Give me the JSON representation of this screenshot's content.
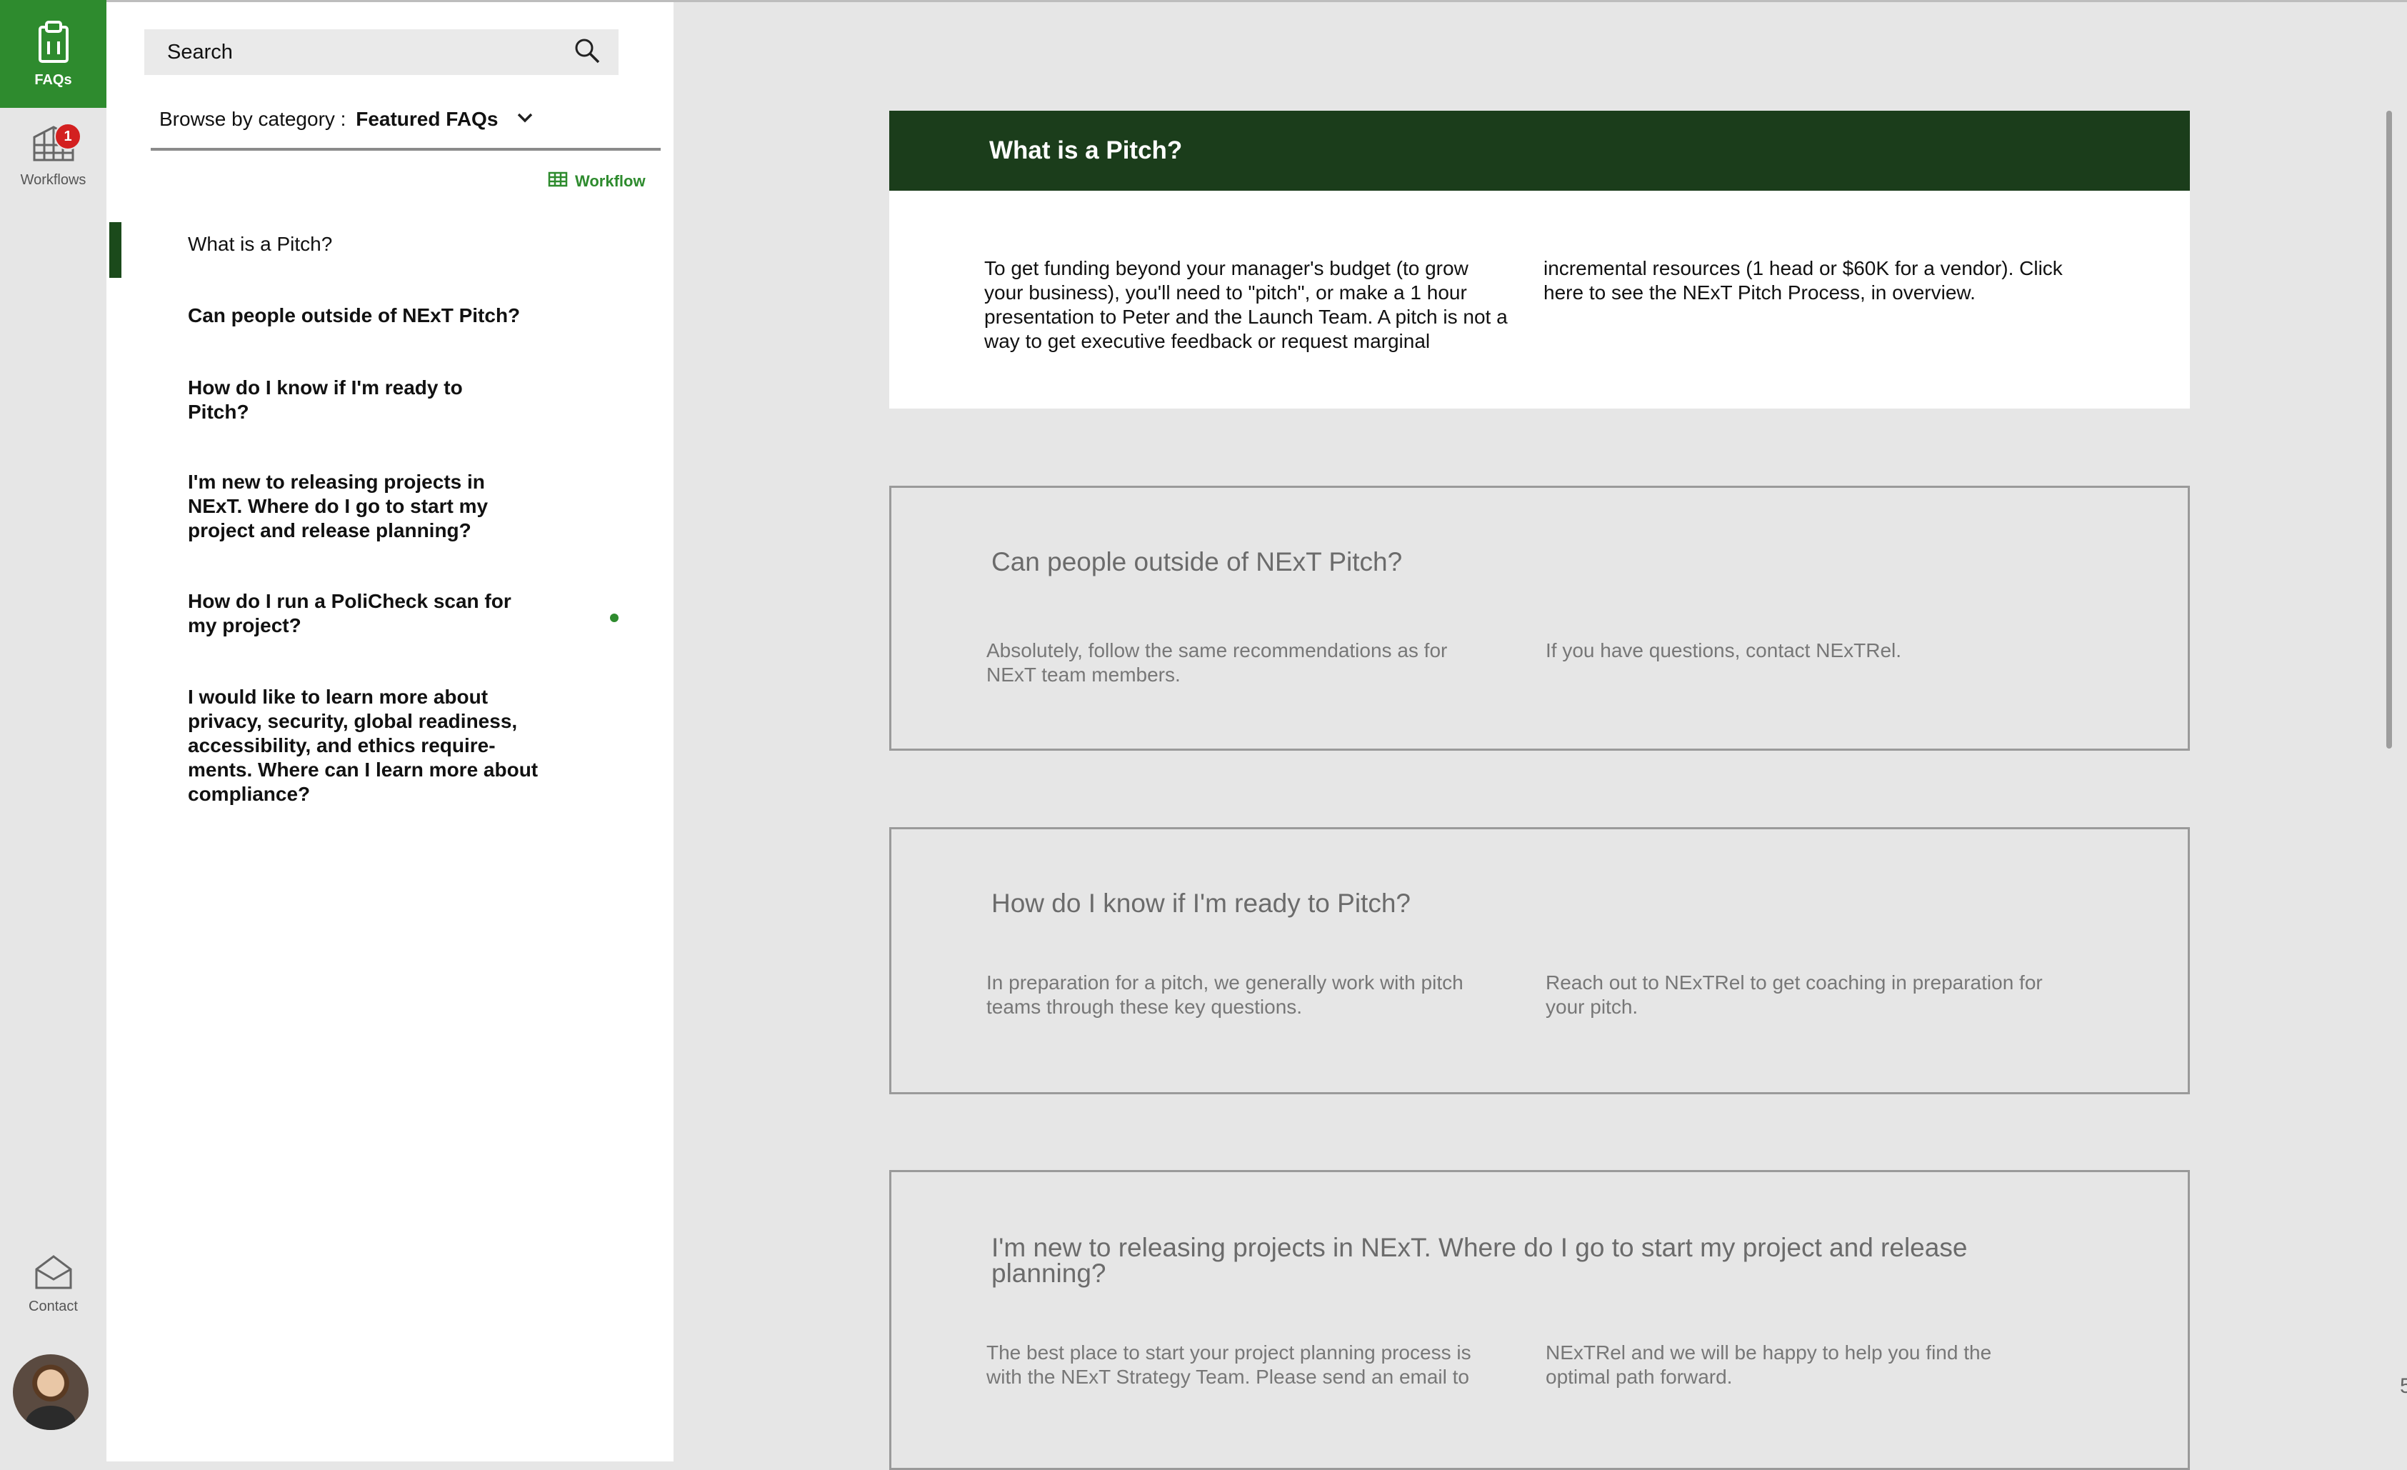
{
  "rail": {
    "faqs_label": "FAQs",
    "workflows_label": "Workflows",
    "workflows_badge": "1",
    "contact_label": "Contact"
  },
  "sidebar": {
    "search_placeholder": "Search",
    "browse_prefix": "Browse by category : ",
    "browse_category": "Featured FAQs",
    "workflow_link": "Workflow",
    "faqs": [
      "What is a Pitch?",
      "Can people outside of NExT Pitch?",
      "How do I know if I'm ready to Pitch?",
      "I'm new to releasing projects in NExT. Where do I go to start my project and release planning?",
      "How do I run a PoliCheck scan for my project?",
      "I would like to learn more about privacy, security, global readiness, accessibility, and ethics require-ments. Where can I learn more about compliance?"
    ]
  },
  "cards": [
    {
      "title": "What is a Pitch?",
      "col1": "To get funding beyond your manager's budget (to grow your business), you'll need to \"pitch\", or make a 1 hour presentation to Peter and the Launch Team. A pitch is not a way to get executive feedback or request marginal",
      "col2": "incremental resources (1 head or $60K for a vendor). Click here to see the NExT Pitch Process, in overview."
    },
    {
      "title": "Can people outside of NExT Pitch?",
      "col1": "Absolutely, follow the same recommendations as for NExT team members.",
      "col2": "If you have questions, contact NExTRel."
    },
    {
      "title": "How do I know if I'm ready to Pitch?",
      "col1": "In preparation for a pitch, we generally work with pitch teams through these key questions.",
      "col2": "Reach out to NExTRel to get coaching in preparation for your pitch."
    },
    {
      "title": "I'm new to releasing projects in NExT. Where do I go to start my project and release planning?",
      "col1": "The best place to start your project planning process is with the NExT Strategy Team. Please send an email to",
      "col2": "NExTRel and we will be happy to help you find the optimal path forward."
    }
  ],
  "edge_number": "5",
  "colors": {
    "accent_green": "#2e8b2e",
    "header_dark_green": "#1b3d1b",
    "badge_red": "#d32020"
  }
}
